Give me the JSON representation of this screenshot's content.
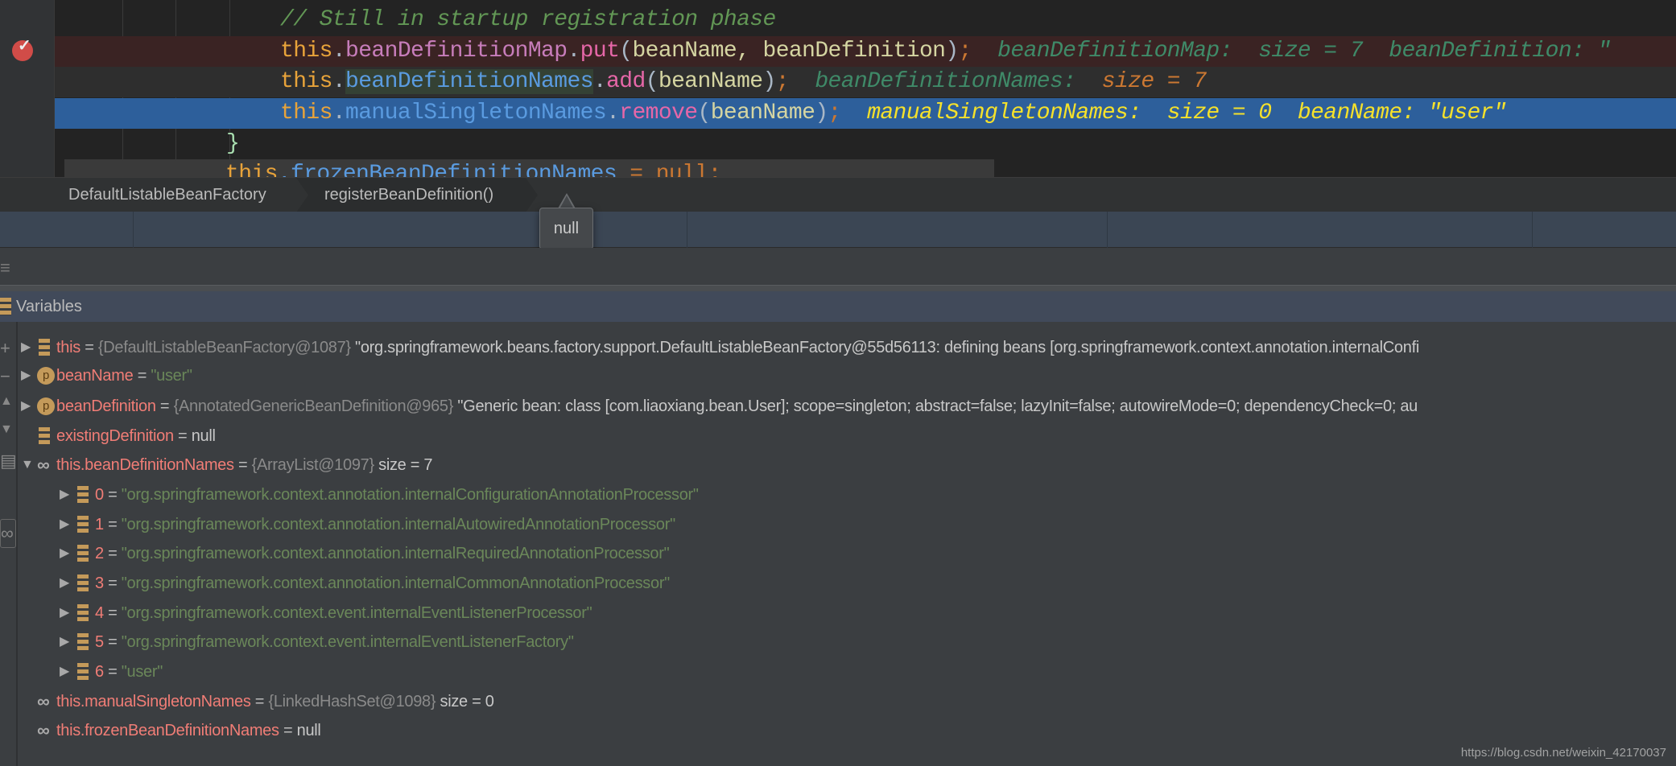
{
  "editor": {
    "comment": "// Still in startup registration phase",
    "line_put": {
      "kw": "this",
      "dot": ".",
      "field": "beanDefinitionMap",
      "dot2": ".",
      "method": "put",
      "open": "(",
      "args": "beanName, beanDefinition",
      "close": ")",
      "semi": ";",
      "hint": "beanDefinitionMap:  size = 7  beanDefinition: \""
    },
    "line_add": {
      "kw": "this",
      "dot": ".",
      "field": "beanDefinitionNames",
      "dot2": ".",
      "method": "add",
      "open": "(",
      "args": "beanName",
      "close": ")",
      "semi": ";",
      "hint_name": "beanDefinitionNames:",
      "hint_value": "size = 7"
    },
    "line_remove": {
      "kw": "this",
      "dot": ".",
      "field": "manualSingletonNames",
      "dot2": ".",
      "method": "remove",
      "open": "(",
      "args": "beanName",
      "close": ")",
      "semi": ";",
      "hint": "manualSingletonNames:  size = 0  beanName: \"user\""
    },
    "brace": "}",
    "line_frozen": {
      "kw": "this",
      "field": ".frozenBeanDefinitionNames",
      "rest": " = null;"
    },
    "breakpoint_icon": "breakpoint-check-icon"
  },
  "breadcrumbs": [
    "DefaultListableBeanFactory",
    "registerBeanDefinition()"
  ],
  "tooltip": "null",
  "variables": {
    "title": "Variables",
    "rows": [
      {
        "exp": "▶",
        "icon": "field",
        "name": "this",
        "eq": " = ",
        "type": "{DefaultListableBeanFactory@1087}",
        "value": " \"org.springframework.beans.factory.support.DefaultListableBeanFactory@55d56113: defining beans [org.springframework.context.annotation.internalConfi",
        "vclass": "vp"
      },
      {
        "exp": "▶",
        "icon": "param",
        "name": "beanName",
        "eq": " = ",
        "type": "",
        "value": "\"user\"",
        "vclass": "vs"
      },
      {
        "exp": "▶",
        "icon": "param",
        "name": "beanDefinition",
        "eq": " = ",
        "type": "{AnnotatedGenericBeanDefinition@965}",
        "value": " \"Generic bean: class [com.liaoxiang.bean.User]; scope=singleton; abstract=false; lazyInit=false; autowireMode=0; dependencyCheck=0; au",
        "vclass": "vp"
      },
      {
        "exp": "",
        "icon": "field",
        "name": "existingDefinition",
        "eq": " = ",
        "type": "",
        "value": "null",
        "vclass": "vp"
      },
      {
        "exp": "▼",
        "icon": "watch",
        "name": "this.beanDefinitionNames",
        "eq": " = ",
        "type": "{ArrayList@1097}",
        "value": "  size = 7",
        "vclass": "vp"
      },
      {
        "exp": "▶",
        "icon": "field",
        "name": "0",
        "eq": " = ",
        "type": "",
        "value": "\"org.springframework.context.annotation.internalConfigurationAnnotationProcessor\"",
        "vclass": "vs",
        "child": true
      },
      {
        "exp": "▶",
        "icon": "field",
        "name": "1",
        "eq": " = ",
        "type": "",
        "value": "\"org.springframework.context.annotation.internalAutowiredAnnotationProcessor\"",
        "vclass": "vs",
        "child": true
      },
      {
        "exp": "▶",
        "icon": "field",
        "name": "2",
        "eq": " = ",
        "type": "",
        "value": "\"org.springframework.context.annotation.internalRequiredAnnotationProcessor\"",
        "vclass": "vs",
        "child": true
      },
      {
        "exp": "▶",
        "icon": "field",
        "name": "3",
        "eq": " = ",
        "type": "",
        "value": "\"org.springframework.context.annotation.internalCommonAnnotationProcessor\"",
        "vclass": "vs",
        "child": true
      },
      {
        "exp": "▶",
        "icon": "field",
        "name": "4",
        "eq": " = ",
        "type": "",
        "value": "\"org.springframework.context.event.internalEventListenerProcessor\"",
        "vclass": "vs",
        "child": true
      },
      {
        "exp": "▶",
        "icon": "field",
        "name": "5",
        "eq": " = ",
        "type": "",
        "value": "\"org.springframework.context.event.internalEventListenerFactory\"",
        "vclass": "vs",
        "child": true
      },
      {
        "exp": "▶",
        "icon": "field",
        "name": "6",
        "eq": " = ",
        "type": "",
        "value": "\"user\"",
        "vclass": "vs",
        "child": true
      },
      {
        "exp": "",
        "icon": "watch",
        "name": "this.manualSingletonNames",
        "eq": " = ",
        "type": "{LinkedHashSet@1098}",
        "value": "  size = 0",
        "vclass": "vp"
      },
      {
        "exp": "",
        "icon": "watch",
        "name": "this.frozenBeanDefinitionNames",
        "eq": " = ",
        "type": "",
        "value": "null",
        "vclass": "vp"
      }
    ]
  },
  "watermark": "https://blog.csdn.net/weixin_42170037"
}
